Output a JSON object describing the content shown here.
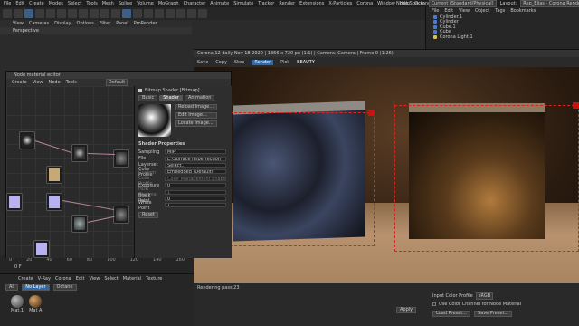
{
  "menubar": {
    "items": [
      "File",
      "Edit",
      "Create",
      "Modes",
      "Select",
      "Tools",
      "Mesh",
      "Spline",
      "Volume",
      "MoGraph",
      "Character",
      "Animate",
      "Simulate",
      "Tracker",
      "Render",
      "Extensions",
      "X-Particles",
      "Corona",
      "Window",
      "Help",
      "Octane"
    ],
    "node_space_label": "Node Space:",
    "node_space_value": "Current (Standard/Physical)",
    "layout_label": "Layout:",
    "layout_value": "Rep_Elias - Corona Renderer Edu (User)"
  },
  "viewport": {
    "menu": [
      "View",
      "Cameras",
      "Display",
      "Options",
      "Filter",
      "Panel",
      "ProRender"
    ],
    "title": "Perspective"
  },
  "object_manager": {
    "tabs": [
      "File",
      "Edit",
      "View",
      "Object",
      "Tags",
      "Bookmarks"
    ],
    "objects": [
      {
        "name": "Cylinder.1",
        "color": "#4a7bd1"
      },
      {
        "name": "Cylinder",
        "color": "#4a7bd1"
      },
      {
        "name": "Cube.1",
        "color": "#4a7bd1"
      },
      {
        "name": "Cube",
        "color": "#4a7bd1"
      },
      {
        "name": "Corona Light.1",
        "color": "#d9c04a"
      }
    ]
  },
  "render_window": {
    "title": "Corona 12 daily Nov 18 2020 | 1366 x 720 px (1:1) | Camera: Camera | Frame 0 (1:26)",
    "toolbar": [
      "Save",
      "Copy",
      "Stop",
      "Render",
      "Pick",
      "BEAUTY"
    ],
    "status": "Rendering pass 23"
  },
  "node_editor": {
    "title": "Node material editor",
    "menu": [
      "Create",
      "View",
      "Node",
      "Tools"
    ],
    "dropdown": "Default",
    "shader_title": "Bitmap Shader [Bitmap]",
    "tabs": [
      "Basic",
      "Shader",
      "Animation"
    ],
    "buttons": [
      "Reload Image...",
      "Edit Image...",
      "Locate Image..."
    ],
    "section": "Shader Properties",
    "props": [
      {
        "label": "Sampling",
        "value": "MIP"
      },
      {
        "label": "File",
        "value": "E:\\Surface Imperfection"
      },
      {
        "label": "Layerset",
        "value": "Select..."
      },
      {
        "label": "Color Profile",
        "value": "Embedded (Default)"
      },
      {
        "label": "Custom Color Profile",
        "value": "Color Management Enable"
      },
      {
        "label": "Exposure",
        "value": "0"
      },
      {
        "label": "HDR Gamma",
        "value": "1"
      },
      {
        "label": "Black Point",
        "value": "0"
      },
      {
        "label": "White Point",
        "value": "1"
      }
    ],
    "reset": "Reset"
  },
  "timeline": {
    "ticks": [
      "0",
      "20",
      "40",
      "60",
      "80",
      "100",
      "120",
      "140",
      "160"
    ],
    "frame": "0 F"
  },
  "material_manager": {
    "menu": [
      "Create",
      "V-Ray",
      "Corona",
      "Edit",
      "View",
      "Select",
      "Material",
      "Texture"
    ],
    "filters": [
      "All",
      "No Layer",
      "Octane"
    ],
    "materials": [
      "Mat.1",
      "Mat A"
    ]
  },
  "bottom": {
    "input_color_profile_label": "Input Color Profile",
    "input_color_profile_value": "sRGB",
    "use_color_channel": "Use Color Channel for Node Material",
    "load_preset": "Load Preset...",
    "save_preset": "Save Preset...",
    "apply": "Apply"
  }
}
